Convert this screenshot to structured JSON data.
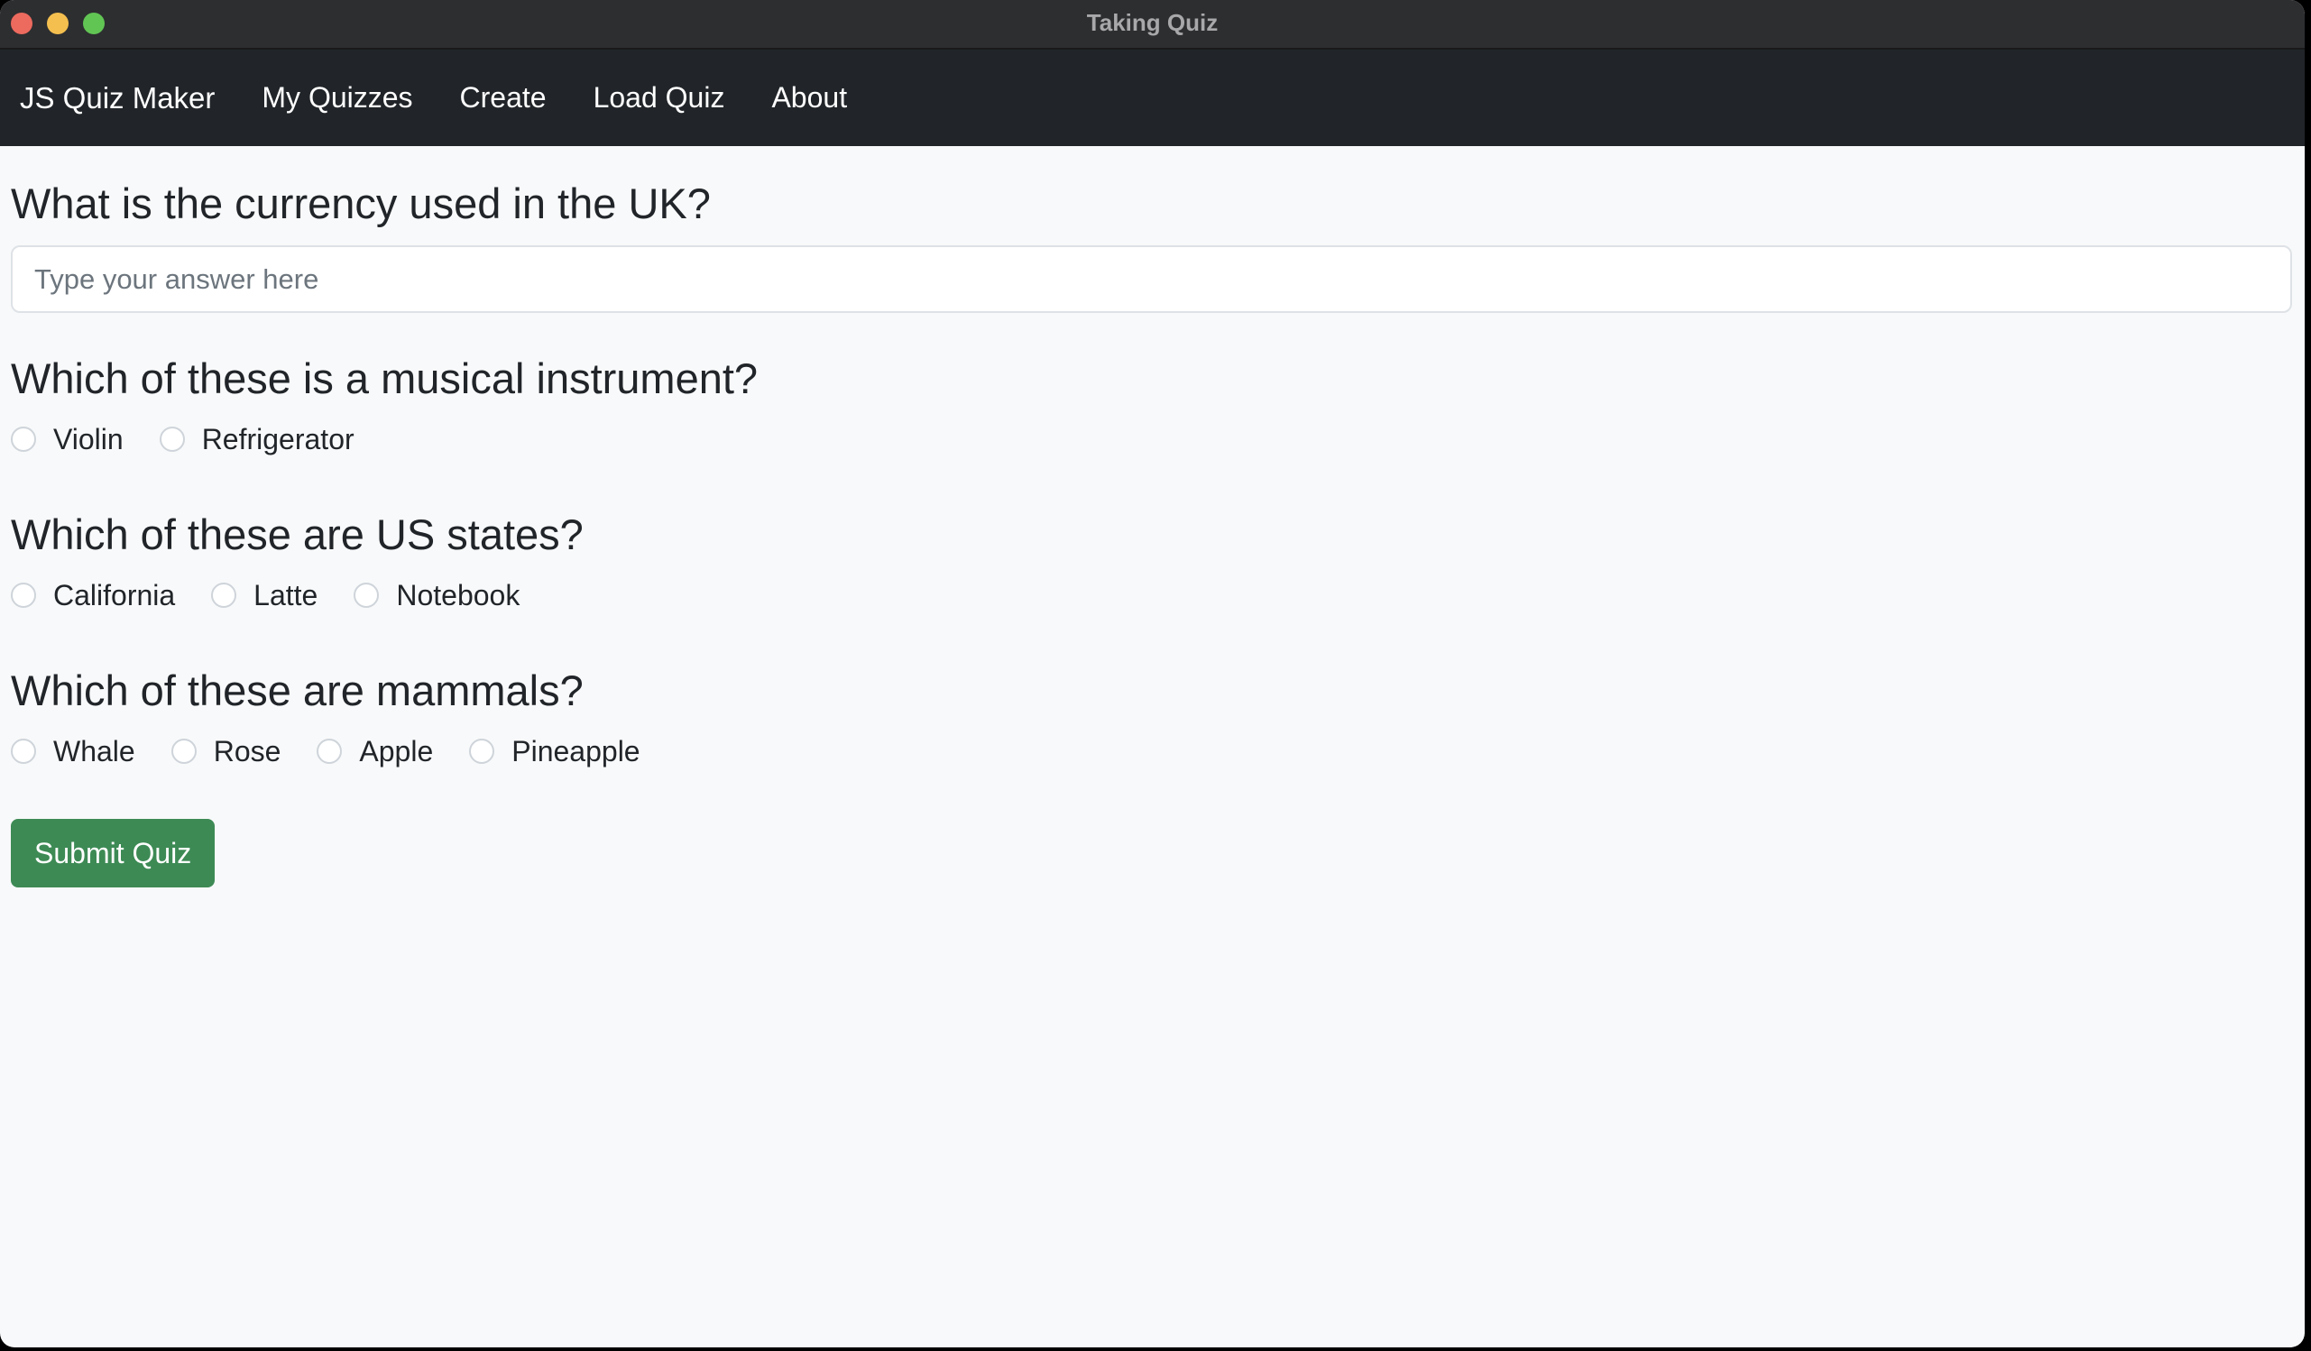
{
  "window": {
    "title": "Taking Quiz"
  },
  "navbar": {
    "brand": "JS Quiz Maker",
    "links": [
      "My Quizzes",
      "Create",
      "Load Quiz",
      "About"
    ]
  },
  "questions": [
    {
      "text": "What is the currency used in the UK?",
      "type": "text",
      "placeholder": "Type your answer here"
    },
    {
      "text": "Which of these is a musical instrument?",
      "type": "radio",
      "options": [
        "Violin",
        "Refrigerator"
      ]
    },
    {
      "text": "Which of these are US states?",
      "type": "radio",
      "options": [
        "California",
        "Latte",
        "Notebook"
      ]
    },
    {
      "text": "Which of these are mammals?",
      "type": "radio",
      "options": [
        "Whale",
        "Rose",
        "Apple",
        "Pineapple"
      ]
    }
  ],
  "submit_label": "Submit Quiz",
  "colors": {
    "navbar_bg": "#212529",
    "submit_bg": "#3d8a55",
    "page_bg": "#f8f9fa"
  }
}
